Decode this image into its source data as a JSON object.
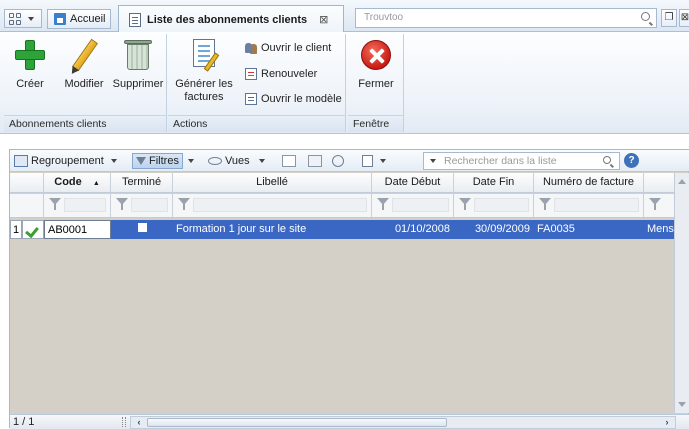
{
  "tabs": {
    "home_label": "Accueil",
    "active_label": "Liste des abonnements clients",
    "search_placeholder": "Trouvtoo"
  },
  "ribbon": {
    "groups": [
      {
        "label": "Abonnements clients",
        "buttons": [
          "Créer",
          "Modifier",
          "Supprimer"
        ]
      },
      {
        "label": "Actions",
        "big_button": "Générer les factures",
        "small_buttons": [
          "Ouvrir le client",
          "Renouveler",
          "Ouvrir le modèle"
        ]
      },
      {
        "label": "Fenêtre",
        "buttons": [
          "Fermer"
        ]
      }
    ]
  },
  "toolbar": {
    "grouping": "Regroupement",
    "filters": "Filtres",
    "views": "Vues",
    "search_placeholder": "Rechercher dans la liste",
    "help": "?"
  },
  "grid": {
    "columns": [
      "Code",
      "Terminé",
      "Libellé",
      "Date Début",
      "Date Fin",
      "Numéro de facture"
    ],
    "sort_column": "Code",
    "rows": [
      {
        "num": "1",
        "code": "AB0001",
        "termine": false,
        "libelle": "Formation 1 jour sur le site",
        "date_debut": "01/10/2008",
        "date_fin": "30/09/2009",
        "facture": "FA0035",
        "extra": "Mens"
      }
    ]
  },
  "status": {
    "pager": "1 / 1"
  },
  "colors": {
    "selection": "#3a66c4",
    "accent": "#3d72b8"
  }
}
